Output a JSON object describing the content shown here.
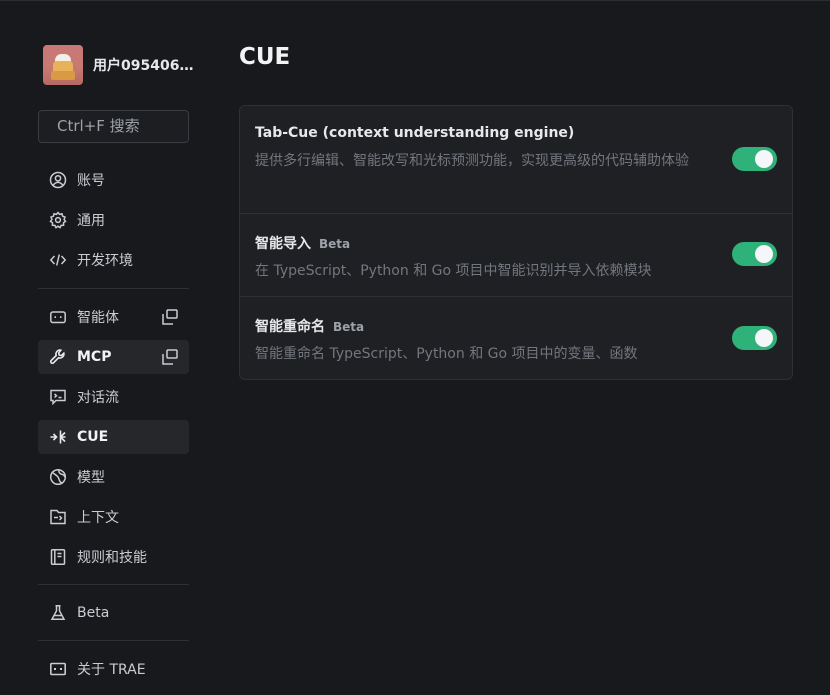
{
  "profile": {
    "username": "用户0954068..."
  },
  "search": {
    "label": "Ctrl+F 搜索"
  },
  "nav": {
    "account": "账号",
    "general": "通用",
    "dev_env": "开发环境",
    "agents": "智能体",
    "mcp": "MCP",
    "dialog_flow": "对话流",
    "cue": "CUE",
    "models": "模型",
    "context": "上下文",
    "rules_skills": "规则和技能",
    "beta": "Beta",
    "about": "关于 TRAE"
  },
  "page": {
    "title": "CUE"
  },
  "settings": [
    {
      "title": "Tab-Cue (context understanding engine)",
      "badge": "",
      "desc": "提供多行编辑、智能改写和光标预测功能，实现更高级的代码辅助体验",
      "enabled": true
    },
    {
      "title": "智能导入",
      "badge": "Beta",
      "desc": "在 TypeScript、Python 和 Go 项目中智能识别并导入依赖模块",
      "enabled": true
    },
    {
      "title": "智能重命名",
      "badge": "Beta",
      "desc": "智能重命名 TypeScript、Python 和 Go 项目中的变量、函数",
      "enabled": true
    }
  ],
  "colors": {
    "accent": "#2fb27a",
    "background": "#18191c",
    "panel": "#1f2024"
  },
  "icons": {
    "account": "user-circle-icon",
    "general": "gear-icon",
    "dev_env": "code-icon",
    "agents": "robot-icon",
    "mcp": "wrench-icon",
    "dialog_flow": "chat-flow-icon",
    "cue": "cue-icon",
    "models": "globe-icon",
    "context": "context-icon",
    "rules_skills": "book-icon",
    "beta": "flask-icon",
    "about": "trae-icon"
  }
}
